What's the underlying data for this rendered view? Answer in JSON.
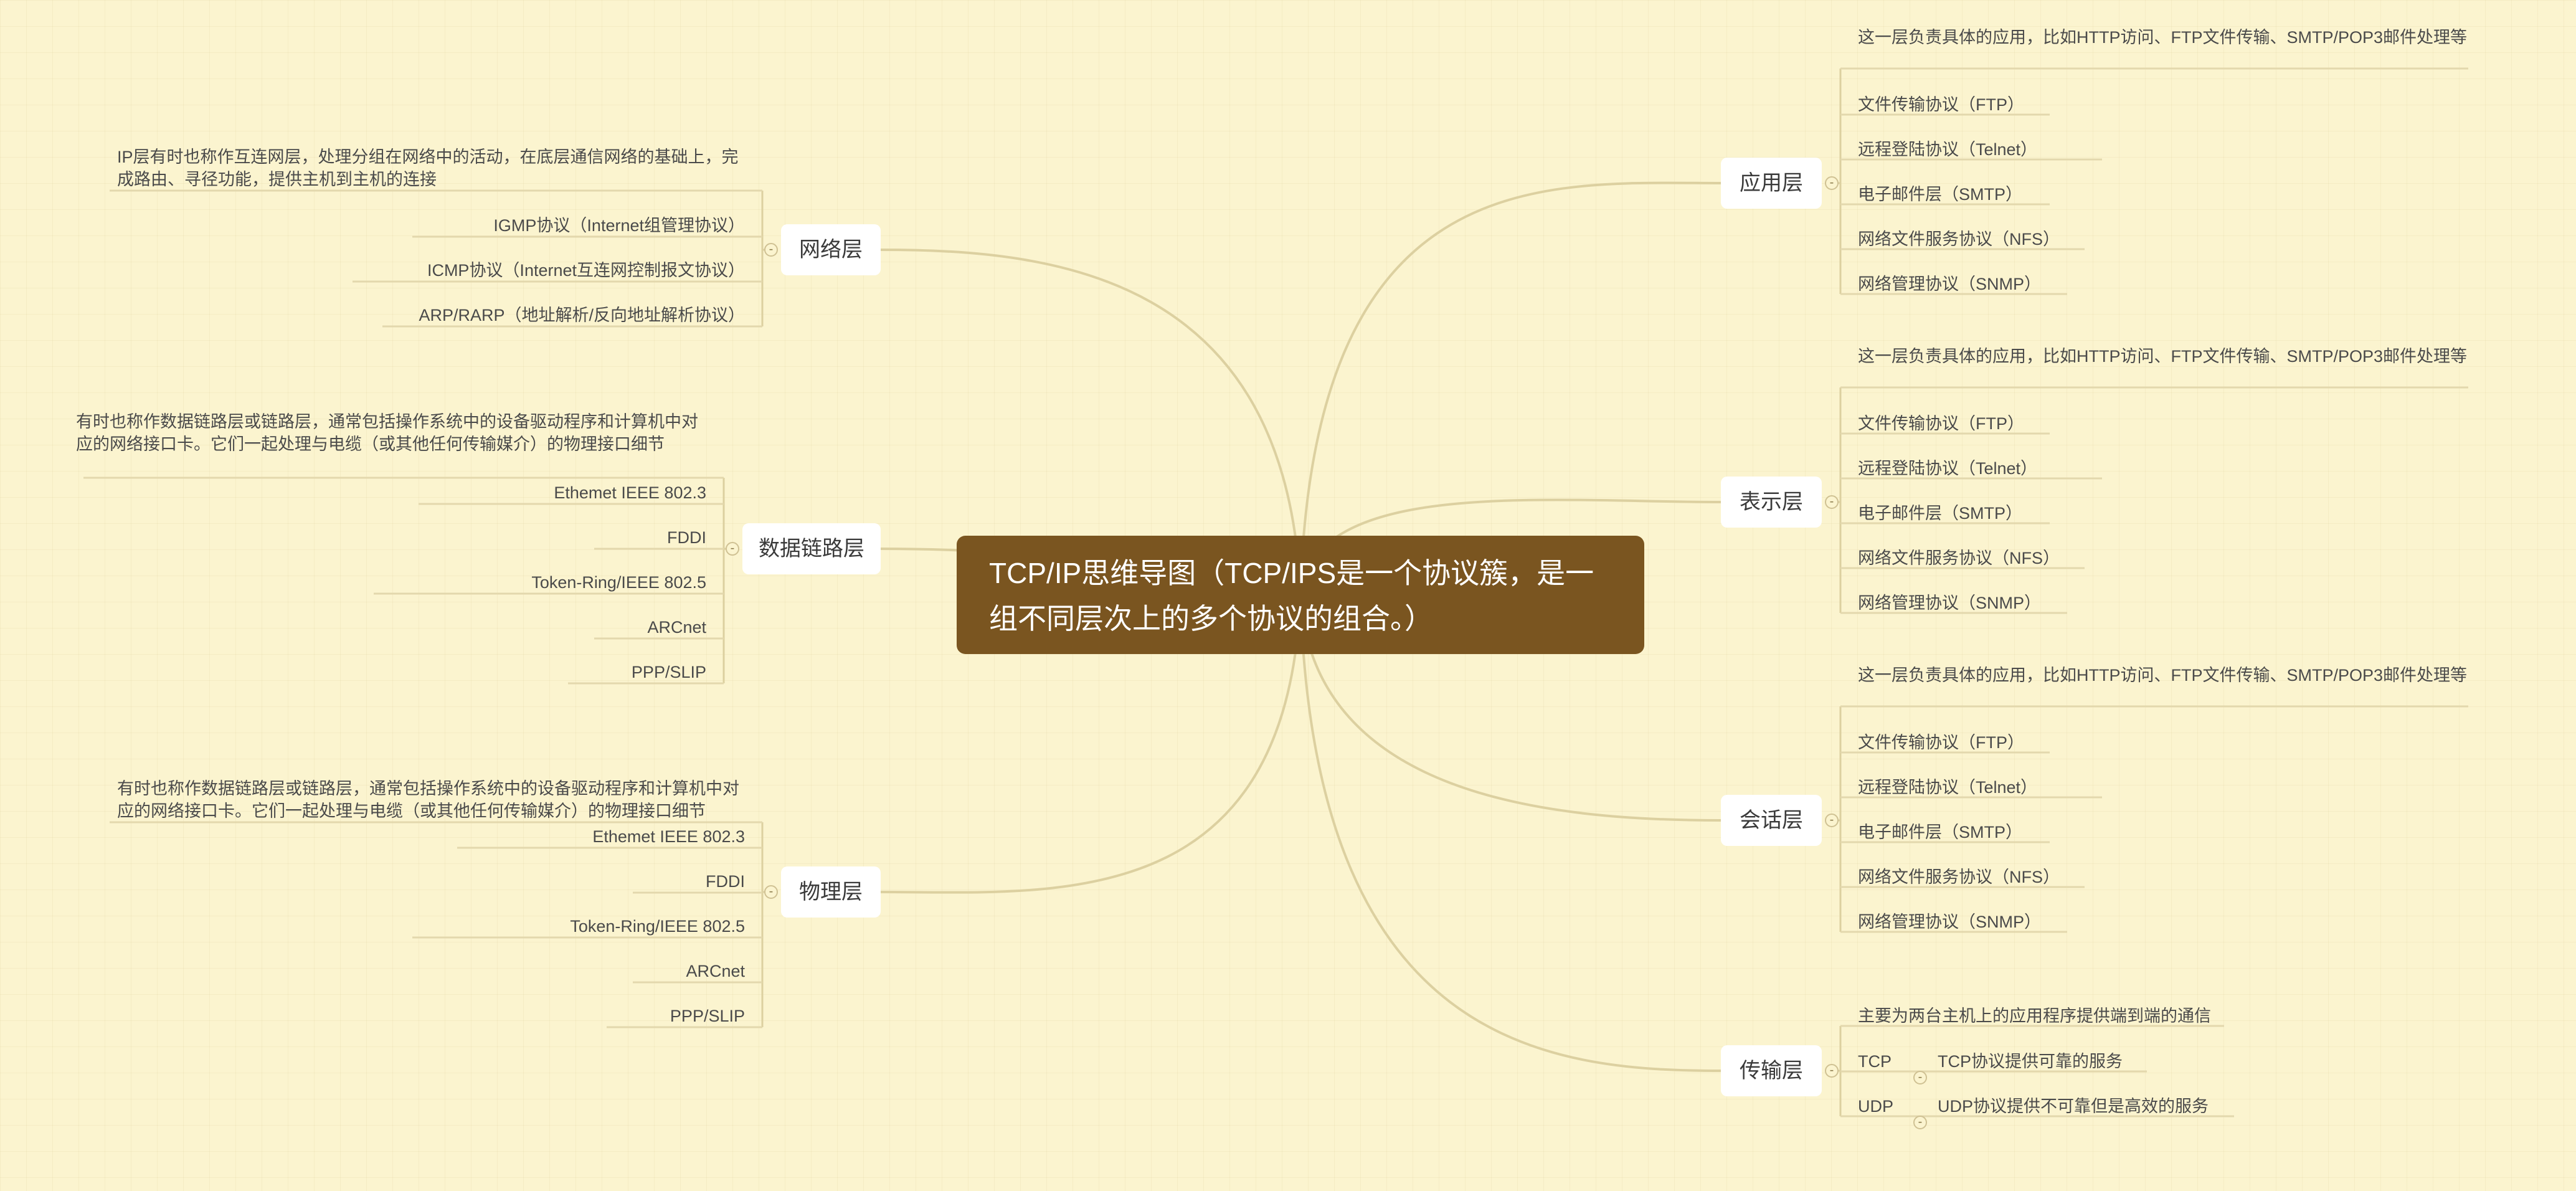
{
  "central_topic": "TCP/IP思维导图（TCP/IPS是一个协议簇，是一组不同层次上的多个协议的组合。）",
  "collapse_symbol": "-",
  "colors": {
    "background": "#fbf4cf",
    "central_fill": "#7a5520",
    "central_text": "#ffffff",
    "branch_line": "#dcd0a0",
    "leaf_underline": "#e3d8ad"
  },
  "right_branches": [
    {
      "label": "应用层",
      "children": [
        "这一层负责具体的应用，比如HTTP访问、FTP文件传输、SMTP/POP3邮件处理等",
        "文件传输协议（FTP）",
        "远程登陆协议（Telnet）",
        "电子邮件层（SMTP）",
        "网络文件服务协议（NFS）",
        "网络管理协议（SNMP）"
      ]
    },
    {
      "label": "表示层",
      "children": [
        "这一层负责具体的应用，比如HTTP访问、FTP文件传输、SMTP/POP3邮件处理等",
        "文件传输协议（FTP）",
        "远程登陆协议（Telnet）",
        "电子邮件层（SMTP）",
        "网络文件服务协议（NFS）",
        "网络管理协议（SNMP）"
      ]
    },
    {
      "label": "会话层",
      "children": [
        "这一层负责具体的应用，比如HTTP访问、FTP文件传输、SMTP/POP3邮件处理等",
        "文件传输协议（FTP）",
        "远程登陆协议（Telnet）",
        "电子邮件层（SMTP）",
        "网络文件服务协议（NFS）",
        "网络管理协议（SNMP）"
      ]
    },
    {
      "label": "传输层",
      "children": [
        "主要为两台主机上的应用程序提供端到端的通信",
        "TCP",
        "UDP"
      ],
      "sub_children": [
        "TCP协议提供可靠的服务",
        "UDP协议提供不可靠但是高效的服务"
      ]
    }
  ],
  "left_branches": [
    {
      "label": "网络层",
      "children": [
        "IP层有时也称作互连网层，处理分组在网络中的活动，在底层通信网络的基础上，完成路由、寻径功能，提供主机到主机的连接",
        "IGMP协议（Internet组管理协议）",
        "ICMP协议（Internet互连网控制报文协议）",
        "ARP/RARP（地址解析/反向地址解析协议）"
      ]
    },
    {
      "label": "数据链路层",
      "children": [
        "有时也称作数据链路层或链路层，通常包括操作系统中的设备驱动程序和计算机中对应的网络接口卡。它们一起处理与电缆（或其他任何传输媒介）的物理接口细节",
        "Ethemet IEEE 802.3",
        "FDDI",
        "Token-Ring/IEEE 802.5",
        "ARCnet",
        "PPP/SLIP"
      ]
    },
    {
      "label": "物理层",
      "children": [
        "有时也称作数据链路层或链路层，通常包括操作系统中的设备驱动程序和计算机中对应的网络接口卡。它们一起处理与电缆（或其他任何传输媒介）的物理接口细节",
        "Ethemet IEEE 802.3",
        "FDDI",
        "Token-Ring/IEEE 802.5",
        "ARCnet",
        "PPP/SLIP"
      ]
    }
  ]
}
